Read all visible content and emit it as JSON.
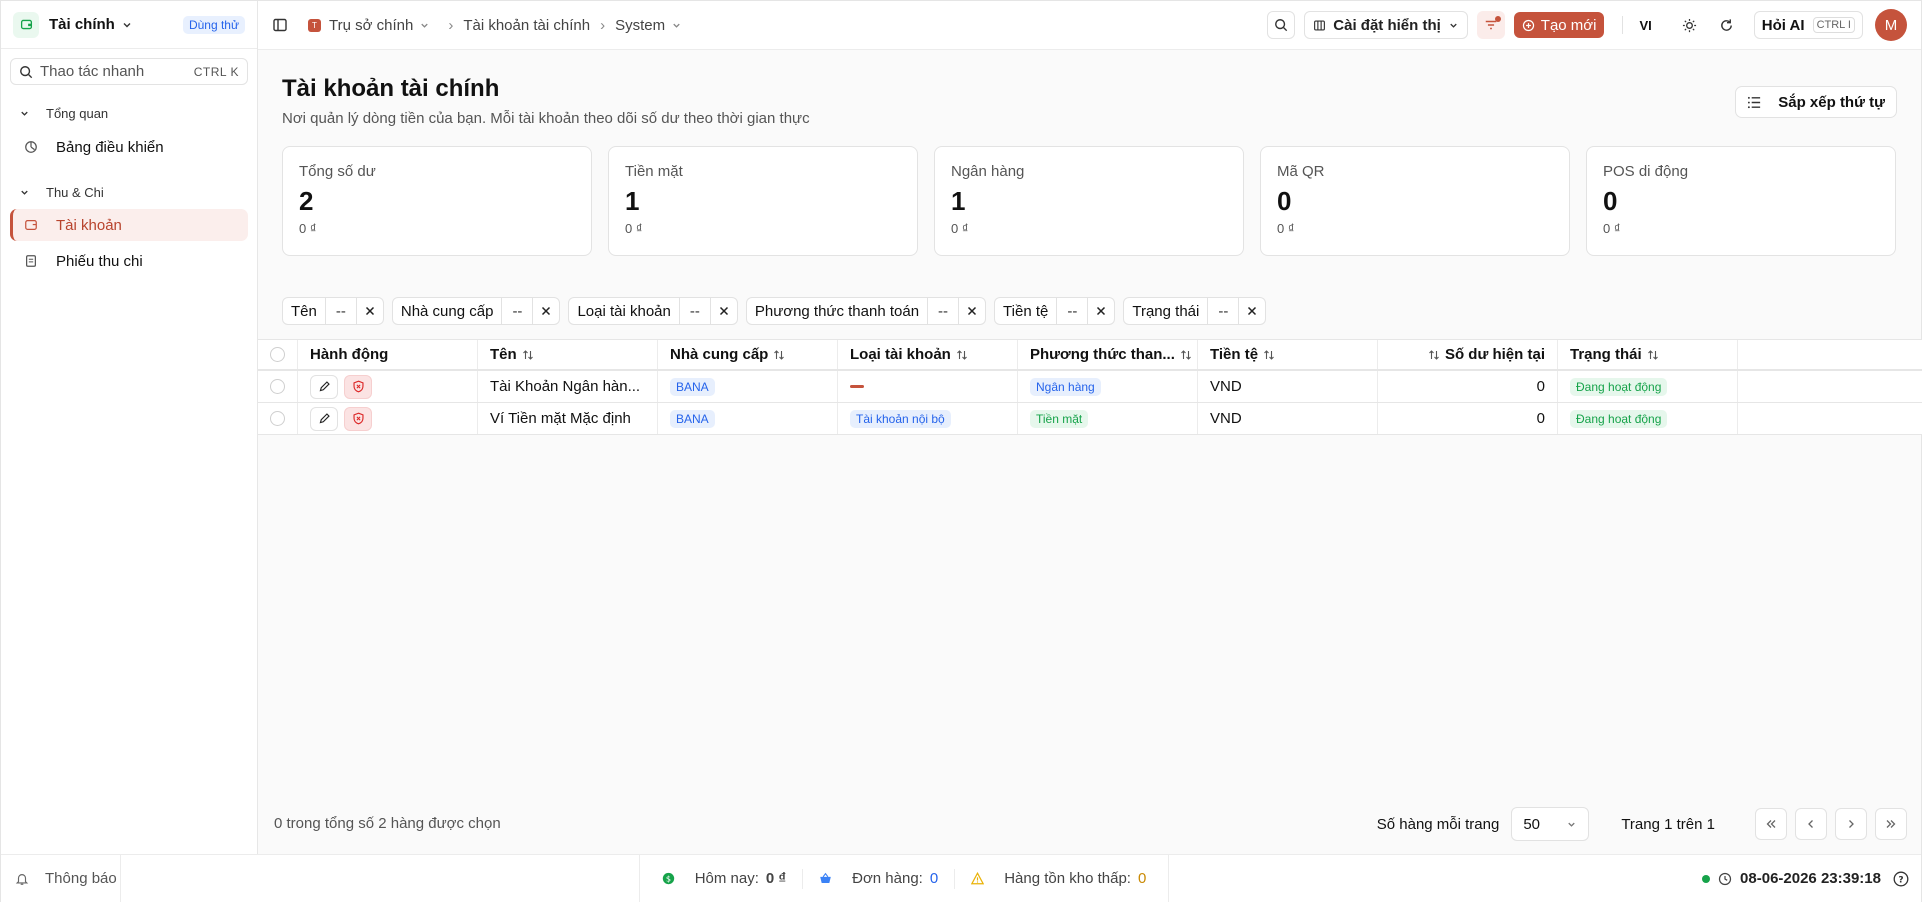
{
  "sidebar": {
    "app_name": "Tài chính",
    "trial_badge": "Dùng thử",
    "quick_action": {
      "placeholder": "Thao tác nhanh",
      "shortcut": "CTRL K"
    },
    "groups": [
      {
        "label": "Tổng quan",
        "items": [
          {
            "label": "Bảng điều khiển",
            "icon": "dashboard-icon",
            "active": false
          }
        ]
      },
      {
        "label": "Thu & Chi",
        "items": [
          {
            "label": "Tài khoản",
            "icon": "wallet-icon",
            "active": true
          },
          {
            "label": "Phiếu thu chi",
            "icon": "document-icon",
            "active": false
          }
        ]
      }
    ]
  },
  "topbar": {
    "breadcrumb": [
      "Trụ sở chính",
      "Tài khoản tài chính",
      "System"
    ],
    "org_initial": "T",
    "display_settings": "Cài đặt hiển thị",
    "create_new": "Tạo mới",
    "language": "VI",
    "ask_ai": "Hỏi AI",
    "ask_ai_shortcut": "CTRL I",
    "avatar_initial": "M"
  },
  "page": {
    "title": "Tài khoản tài chính",
    "subtitle": "Nơi quản lý dòng tiền của bạn. Mỗi tài khoản theo dõi số dư theo thời gian thực",
    "sort_button": "Sắp xếp thứ tự"
  },
  "summary_cards": [
    {
      "label": "Tổng số dư",
      "value": "2",
      "amount": "0 ₫"
    },
    {
      "label": "Tiền mặt",
      "value": "1",
      "amount": "0 ₫"
    },
    {
      "label": "Ngân hàng",
      "value": "1",
      "amount": "0 ₫"
    },
    {
      "label": "Mã QR",
      "value": "0",
      "amount": "0 ₫"
    },
    {
      "label": "POS di động",
      "value": "0",
      "amount": "0 ₫"
    }
  ],
  "filters": [
    {
      "label": "Tên",
      "value": "--"
    },
    {
      "label": "Nhà cung cấp",
      "value": "--"
    },
    {
      "label": "Loại tài khoản",
      "value": "--"
    },
    {
      "label": "Phương thức thanh toán",
      "value": "--"
    },
    {
      "label": "Tiền tệ",
      "value": "--"
    },
    {
      "label": "Trạng thái",
      "value": "--"
    }
  ],
  "table": {
    "columns": [
      "Hành động",
      "Tên",
      "Nhà cung cấp",
      "Loại tài khoản",
      "Phương thức than...",
      "Tiền tệ",
      "Số dư hiện tại",
      "Trạng thái"
    ],
    "rows": [
      {
        "name": "Tài Khoản Ngân hàn...",
        "provider": "BANA",
        "account_type": "",
        "payment_method": "Ngân hàng",
        "currency": "VND",
        "balance": "0",
        "status": "Đang hoạt động"
      },
      {
        "name": "Ví Tiền mặt Mặc định",
        "provider": "BANA",
        "account_type": "Tài khoản nội bộ",
        "payment_method": "Tiền mặt",
        "currency": "VND",
        "balance": "0",
        "status": "Đang hoạt động"
      }
    ]
  },
  "footer": {
    "selection": "0 trong tổng số 2 hàng được chọn",
    "rows_per_page_label": "Số hàng mỗi trang",
    "rows_per_page": "50",
    "page_info": "Trang 1 trên 1"
  },
  "statusbar": {
    "notifications": "Thông báo",
    "today_label": "Hôm nay:",
    "today_value": "0 ₫",
    "orders_label": "Đơn hàng:",
    "orders_value": "0",
    "low_stock_label": "Hàng tồn kho thấp:",
    "low_stock_value": "0",
    "datetime": "08-06-2026 23:39:18"
  },
  "colors": {
    "accent": "#c5533c",
    "blue_badge": "#2563eb",
    "green_badge": "#16a34a",
    "warning": "#eab308"
  }
}
